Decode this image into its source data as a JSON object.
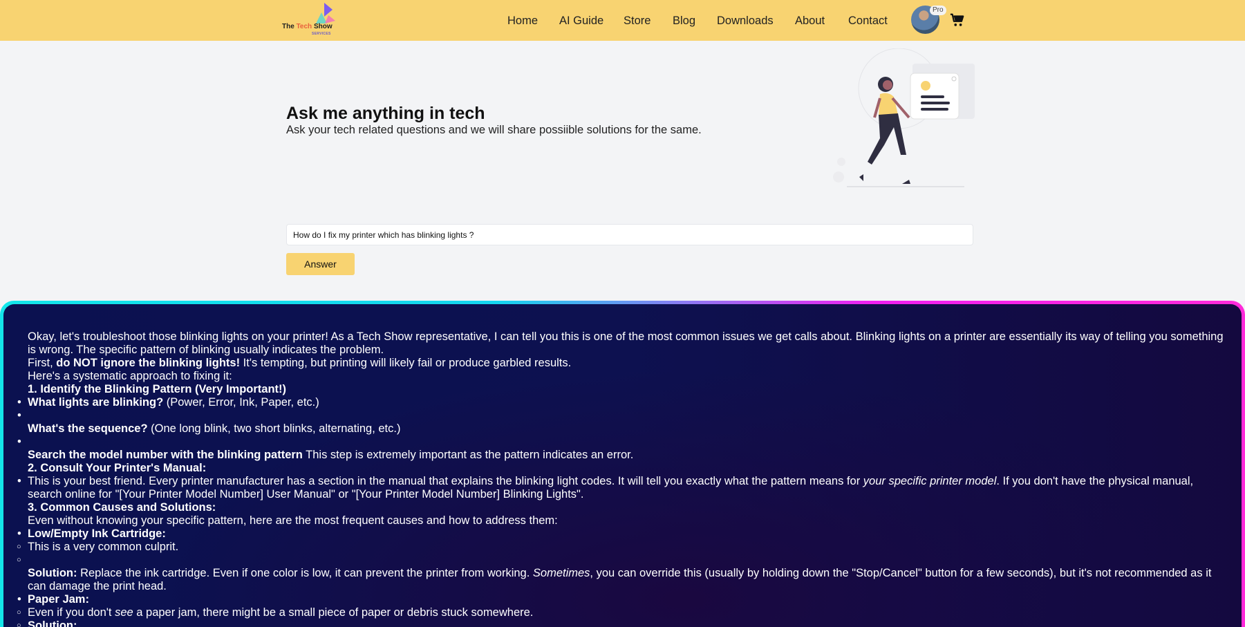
{
  "nav": {
    "logo_prefix": "The ",
    "logo_accent": "Tech",
    "logo_suffix": " Show",
    "logo_sub": "SERVICES",
    "items": [
      "Home",
      "AI Guide",
      "Store",
      "Blog",
      "Downloads",
      "About",
      "Contact"
    ],
    "badge": "Pro",
    "bg_color": "#f8d371"
  },
  "hero": {
    "title": "Ask me anything in tech",
    "subtitle": "Ask your tech related questions and we will share possiible solutions for the same."
  },
  "ask": {
    "question_value": "How do I fix my printer which has blinking lights ?",
    "button_label": "Answer"
  },
  "response": {
    "intro": "Okay, let's troubleshoot those blinking lights on your printer! As a Tech Show representative, I can tell you this is one of the most common issues we get calls about. Blinking lights on a printer are essentially its way of telling you something is wrong. The specific pattern of blinking usually indicates the problem.",
    "first_pre": "First, ",
    "first_bold": "do NOT ignore the blinking lights!",
    "first_post": " It's tempting, but printing will likely fail or produce garbled results.",
    "approach": "Here's a systematic approach to fixing it:",
    "h1": "1. Identify the Blinking Pattern (Very Important!)",
    "b1_bold": "What lights are blinking?",
    "b1_text": " (Power, Error, Ink, Paper, etc.)",
    "b2_bold": "What's the sequence?",
    "b2_text": " (One long blink, two short blinks, alternating, etc.)",
    "b3_bold": "Search the model number with the blinking pattern",
    "b3_text": " This step is extremely important as the pattern indicates an error.",
    "h2": "2. Consult Your Printer's Manual:",
    "b4_pre": "This is your best friend. Every printer manufacturer has a section in the manual that explains the blinking light codes. It will tell you exactly what the pattern means for ",
    "b4_em": "your specific printer model",
    "b4_post": ". If you don't have the physical manual, search online for \"[Your Printer Model Number] User Manual\" or \"[Your Printer Model Number] Blinking Lights\".",
    "h3": "3. Common Causes and Solutions:",
    "causes_intro": "Even without knowing your specific pattern, here are the most frequent causes and how to address them:",
    "c1_title": "Low/Empty Ink Cartridge:",
    "c1_note": "This is a very common culprit.",
    "c1_sol_bold": "Solution:",
    "c1_sol_pre": " Replace the ink cartridge. Even if one color is low, it can prevent the printer from working. ",
    "c1_sol_em": "Sometimes",
    "c1_sol_post": ", you can override this (usually by holding down the \"Stop/Cancel\" button for a few seconds), but it's not recommended as it can damage the print head.",
    "c2_title": "Paper Jam:",
    "c2_pre": "Even if you don't ",
    "c2_em": "see",
    "c2_post": " a paper jam, there might be a small piece of paper or debris stuck somewhere.",
    "c2_sol": "Solution:"
  }
}
